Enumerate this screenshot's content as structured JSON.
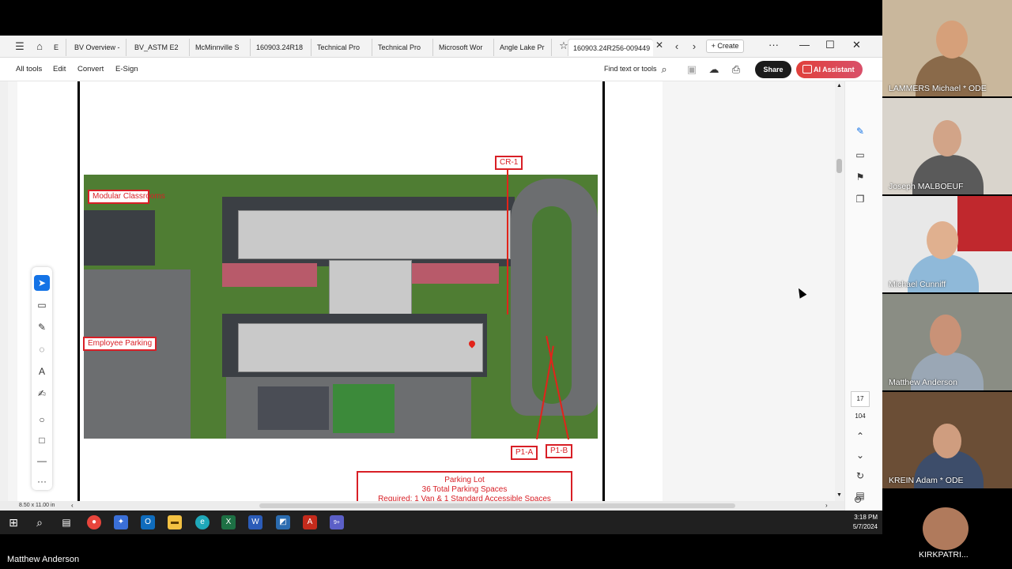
{
  "browser": {
    "tabs": [
      {
        "label": "E"
      },
      {
        "label": "BV Overview -"
      },
      {
        "label": "BV_ASTM E2"
      },
      {
        "label": "McMinnville S"
      },
      {
        "label": "160903.24R18"
      },
      {
        "label": "Technical Pro"
      },
      {
        "label": "Technical Pro"
      },
      {
        "label": "Microsoft Wor"
      },
      {
        "label": "Angle Lake Pr"
      },
      {
        "label": "160903.24R256-009449"
      }
    ],
    "create_label": "Create"
  },
  "toolbar": {
    "menus": [
      "All tools",
      "Edit",
      "Convert",
      "E-Sign"
    ],
    "find_text": "Find text or tools",
    "share_label": "Share",
    "ai_label": "AI Assistant"
  },
  "document": {
    "labels": {
      "modular": "Modular Classrooms",
      "employee": "Employee Parking",
      "cr1": "CR-1",
      "p1a": "P1-A",
      "p1b": "P1-B"
    },
    "parking_box": {
      "line1": "Parking Lot",
      "line2": "36 Total Parking Spaces",
      "line3": "Required: 1 Van & 1 Standard Accessible Spaces"
    },
    "page_size": "8.50 x 11.00 in"
  },
  "page_nav": {
    "current": "17",
    "total": "104"
  },
  "taskbar": {
    "time": "3:18 PM",
    "date": "5/7/2024",
    "teams_badge": "9+"
  },
  "meeting": {
    "presenter": "Matthew Anderson",
    "participants": [
      {
        "name": "LAMMERS Michael * ODE"
      },
      {
        "name": "Joseph MALBOEUF"
      },
      {
        "name": "Michael Cunniff"
      },
      {
        "name": "Matthew Anderson"
      },
      {
        "name": "KREIN Adam * ODE"
      },
      {
        "name": "KIRKPATRI..."
      }
    ]
  },
  "colors": {
    "accent": "#1473e6",
    "annotation_red": "#d81f26",
    "share_bg": "#1b1b1b",
    "ai_gradient": "#e0403b"
  },
  "icons": [
    "home-icon",
    "star-icon",
    "search-icon",
    "save-icon",
    "upload-icon",
    "print-icon",
    "cursor-icon",
    "comment-icon",
    "pen-icon",
    "lasso-icon",
    "text-icon",
    "sign-icon",
    "circle-icon",
    "square-icon",
    "line-icon",
    "more-icon"
  ]
}
